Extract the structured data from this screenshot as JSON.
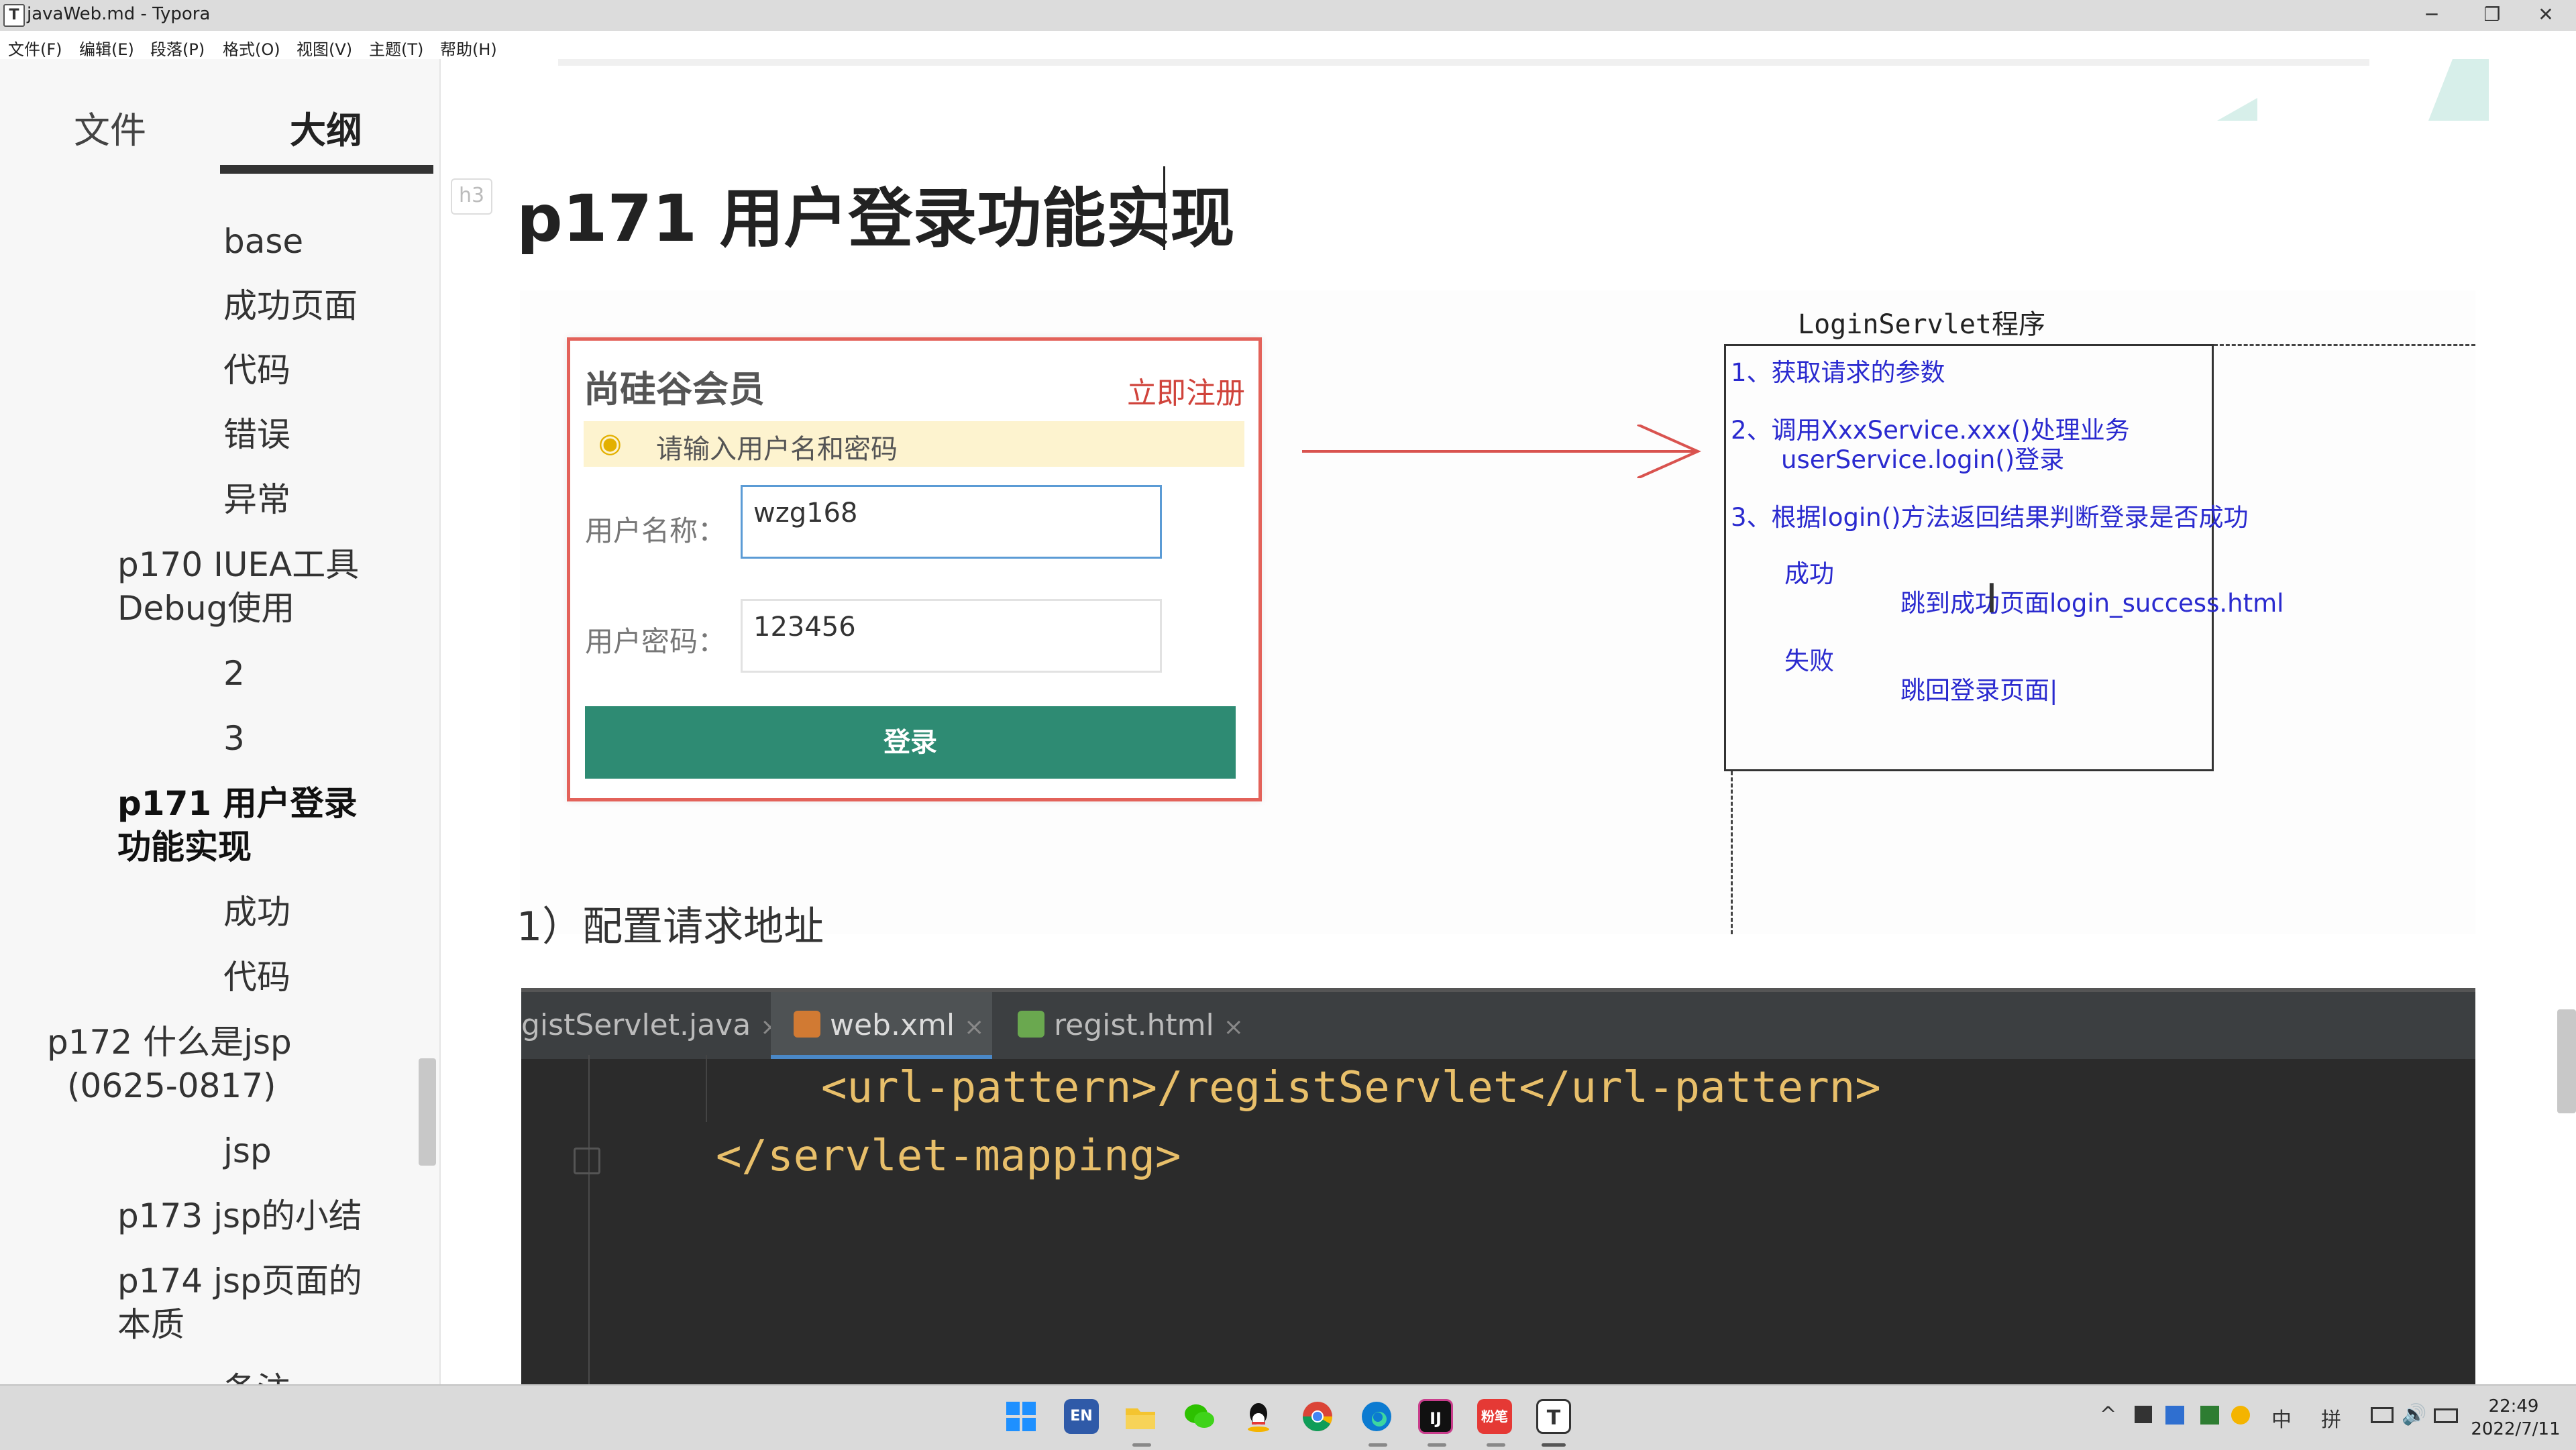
{
  "window": {
    "title": "javaWeb.md - Typora",
    "app_icon": "T",
    "controls": {
      "minimize": "─",
      "maximize": "❐",
      "close": "✕"
    }
  },
  "menubar": [
    "文件(F)",
    "编辑(E)",
    "段落(P)",
    "格式(O)",
    "视图(V)",
    "主题(T)",
    "帮助(H)"
  ],
  "sidebar": {
    "tabs": [
      {
        "label": "文件",
        "active": false
      },
      {
        "label": "大纲",
        "active": true
      }
    ],
    "outline": [
      "base",
      "成功页面",
      "代码",
      "错误",
      "异常",
      "p170 IUEA工具",
      "Debug使用",
      "2",
      "3",
      "p171 用户登录",
      "功能实现",
      "成功",
      "代码",
      "p172 什么是jsp",
      "(0625-0817)",
      "jsp",
      "p173 jsp的小结",
      "p174 jsp页面的",
      "本质",
      "备注"
    ]
  },
  "editor": {
    "heading_tag": "h3",
    "heading": "p171 用户登录功能实现",
    "subheading": "1）配置请求地址"
  },
  "login_form": {
    "title": "尚硅谷会员",
    "register_link": "立即注册",
    "hint": "请输入用户名和密码",
    "username_label": "用户名称：",
    "username_value": "wzg168",
    "password_label": "用户密码：",
    "password_value": "123456",
    "submit_label": "登录"
  },
  "servlet": {
    "title": "LoginServlet程序",
    "lines": [
      "1、获取请求的参数",
      "2、调用XxxService.xxx()处理业务",
      "userService.login()登录",
      "3、根据login()方法返回结果判断登录是否成功",
      "成功",
      "跳到成功页面login_success.html",
      "失败",
      "跳回登录页面|"
    ]
  },
  "code": {
    "tabs": [
      {
        "label": "gistServlet.java",
        "active": false,
        "close": "×"
      },
      {
        "label": "web.xml",
        "active": true,
        "close": "×"
      },
      {
        "label": "regist.html",
        "active": false,
        "close": "×"
      }
    ],
    "lines": [
      "<url-pattern>/registServlet</url-pattern>",
      "</servlet-mapping>"
    ]
  },
  "taskbar": {
    "icons": [
      "windows-start-icon",
      "en-keyboard-icon",
      "file-explorer-icon",
      "wechat-icon",
      "qq-icon",
      "chrome-icon",
      "edge-icon",
      "intellij-icon",
      "app-red-icon",
      "typora-icon"
    ],
    "en_label": "EN",
    "red_label": "粉笔",
    "typora_label": "T",
    "tray": {
      "chevron": "^",
      "ime_mode": "中",
      "ime_name": "拼"
    },
    "time": "22:49",
    "date": "2022/7/11"
  }
}
